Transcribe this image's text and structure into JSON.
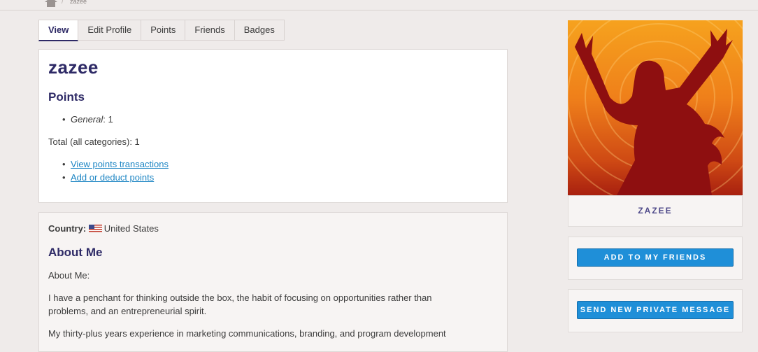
{
  "breadcrumb": {
    "current": "zazee"
  },
  "tabs": [
    {
      "label": "View"
    },
    {
      "label": "Edit Profile"
    },
    {
      "label": "Points"
    },
    {
      "label": "Friends"
    },
    {
      "label": "Badges"
    }
  ],
  "profile": {
    "username": "zazee",
    "points_heading": "Points",
    "general_label": "General",
    "general_value": ": 1",
    "total_text": "Total (all categories): 1",
    "link_view_transactions": "View points transactions",
    "link_add_deduct": "Add or deduct points"
  },
  "about": {
    "country_label": "Country:",
    "country_value": "United States",
    "heading": "About Me",
    "intro": "About Me:",
    "para1_line1": "I have a penchant for thinking outside the box, the habit of focusing on opportunities rather than",
    "para1_line2": "problems, and an entrepreneurial spirit.",
    "para2_line1": "My thirty-plus years experience in marketing communications, branding, and program development"
  },
  "sidebar": {
    "display_name": "ZAZEE",
    "add_friend_button": "ADD TO MY FRIENDS",
    "message_button": "SEND NEW PRIVATE MESSAGE"
  },
  "colors": {
    "accent": "#2e2a66",
    "link": "#1e86c4",
    "button": "#1f8fd8",
    "background": "#efebea"
  }
}
